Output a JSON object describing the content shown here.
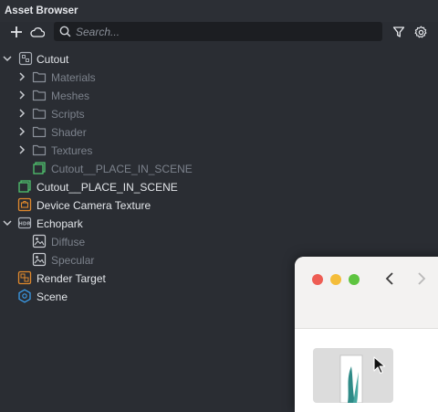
{
  "panel": {
    "title": "Asset Browser"
  },
  "toolbar": {
    "search_placeholder": "Search..."
  },
  "tree": [
    {
      "label": "Cutout",
      "icon": "package-icon",
      "expanded": true,
      "level": 0
    },
    {
      "label": "Materials",
      "icon": "folder-icon",
      "level": 1
    },
    {
      "label": "Meshes",
      "icon": "folder-icon",
      "level": 1
    },
    {
      "label": "Scripts",
      "icon": "folder-icon",
      "level": 1
    },
    {
      "label": "Shader",
      "icon": "folder-icon",
      "level": 1
    },
    {
      "label": "Textures",
      "icon": "folder-icon",
      "level": 1
    },
    {
      "label": "Cutout__PLACE_IN_SCENE",
      "icon": "prefab-icon",
      "level": 1
    },
    {
      "label": "Cutout__PLACE_IN_SCENE",
      "icon": "prefab-icon",
      "level": 0
    },
    {
      "label": "Device Camera Texture",
      "icon": "camera-texture-icon",
      "level": 0
    },
    {
      "label": "Echopark",
      "icon": "hdr-icon",
      "expanded": true,
      "level": 0
    },
    {
      "label": "Diffuse",
      "icon": "image-icon",
      "level": 1
    },
    {
      "label": "Specular",
      "icon": "image-icon",
      "level": 1
    },
    {
      "label": "Render Target",
      "icon": "render-target-icon",
      "level": 0
    },
    {
      "label": "Scene",
      "icon": "scene-icon",
      "level": 0
    }
  ],
  "colors": {
    "background": "#2a2d33",
    "folder": "#8a9099",
    "prefab_green": "#4fc36e",
    "orange": "#e0892c",
    "scene_blue": "#3a9be8",
    "mac_close": "#ee5d54",
    "mac_minimize": "#f4bd3a",
    "mac_zoom": "#5ec440"
  }
}
